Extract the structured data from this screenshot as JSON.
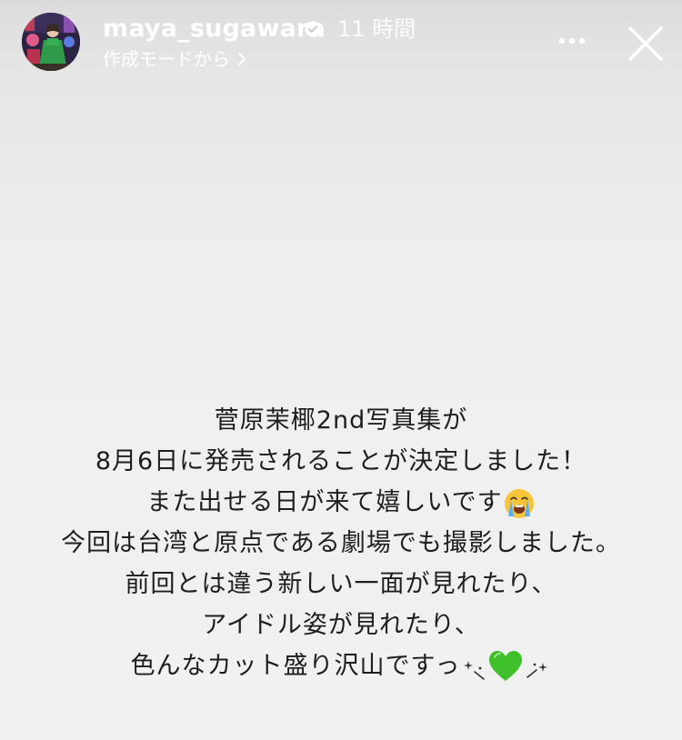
{
  "header": {
    "username": "maya_sugawara",
    "verified_icon": "verified-badge-icon",
    "time_ago": "11 時間",
    "subline": "作成モードから",
    "subline_icon": "chevron-right-icon",
    "more_icon": "more-dots-icon",
    "close_icon": "close-icon",
    "avatar": "profile-avatar"
  },
  "story": {
    "lines": [
      "菅原茉椰2nd写真集が",
      "8月6日に発売されることが決定しました！",
      "また出せる日が来て嬉しいです",
      "今回は台湾と原点である劇場でも撮影しました。",
      "前回とは違う新しい一面が見れたり、",
      "アイドル姿が見れたり、",
      "色んなカット盛り沢山ですっ"
    ],
    "emoji": {
      "crying": "loudly-crying-face-emoji",
      "sparkle": "sparkle-icon",
      "heart": "green-heart-emoji"
    }
  },
  "colors": {
    "background": "#eeeeee",
    "header_text": "#ffffff",
    "story_text": "#1e1e1e",
    "heart": "#3fbf2a"
  }
}
